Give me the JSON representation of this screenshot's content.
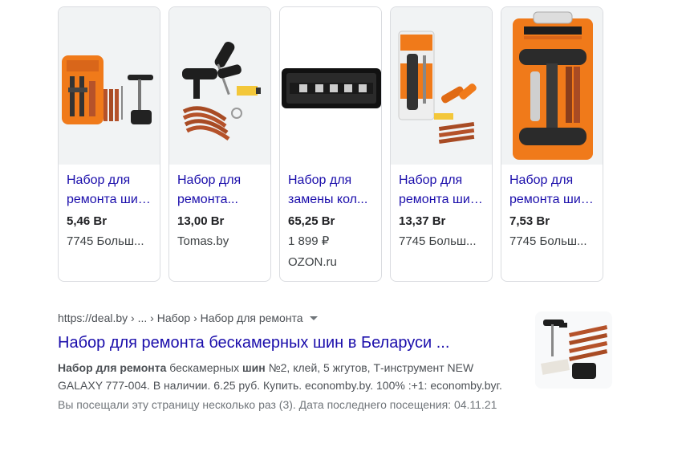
{
  "products": [
    {
      "title_line1": "Набор для",
      "title_line2": "ремонта шин...",
      "price": "5,46 Br",
      "merchant": "7745 Больш...",
      "image": "tire-repair-kit-orange-pack"
    },
    {
      "title_line1": "Набор для",
      "title_line2": "ремонта...",
      "price": "13,00 Br",
      "merchant": "Tomas.by",
      "image": "tire-repair-kit-black-tools"
    },
    {
      "title_line1": "Набор для",
      "title_line2": "замены кол...",
      "price": "65,25 Br",
      "merchant": "1 899 ₽",
      "merchant_line2": "OZON.ru",
      "image": "wheel-tool-case"
    },
    {
      "title_line1": "Набор для",
      "title_line2": "ремонта шин...",
      "price": "13,37 Br",
      "merchant": "7745 Больш...",
      "image": "tire-repair-kit-blister"
    },
    {
      "title_line1": "Набор для",
      "title_line2": "ремонта шин...",
      "price": "7,53 Br",
      "merchant": "7745 Больш...",
      "image": "remkomplekt-orange-pack"
    }
  ],
  "result": {
    "breadcrumb": "https://deal.by › ... › Набор › Набор для ремонта",
    "title": "Набор для ремонта бескамерных шин в Беларуси ...",
    "snippet_bold1": "Набор для ремонта",
    "snippet_text1": " бескамерных ",
    "snippet_bold2": "шин",
    "snippet_text2": " №2, клей, 5 жгутов, Т-инструмент NEW GALAXY 777-004. В наличии. 6.25 руб. Купить. economby.by. 100% :+1: economby.byг.",
    "visited": "Вы посещали эту страницу несколько раз (3). Дата последнего посещения: 04.11.21",
    "thumbnail": "tire-repair-kit-thumbnail"
  },
  "colors": {
    "link": "#1a0dab",
    "orange": "#f07a1a",
    "plug": "#b5522a"
  }
}
